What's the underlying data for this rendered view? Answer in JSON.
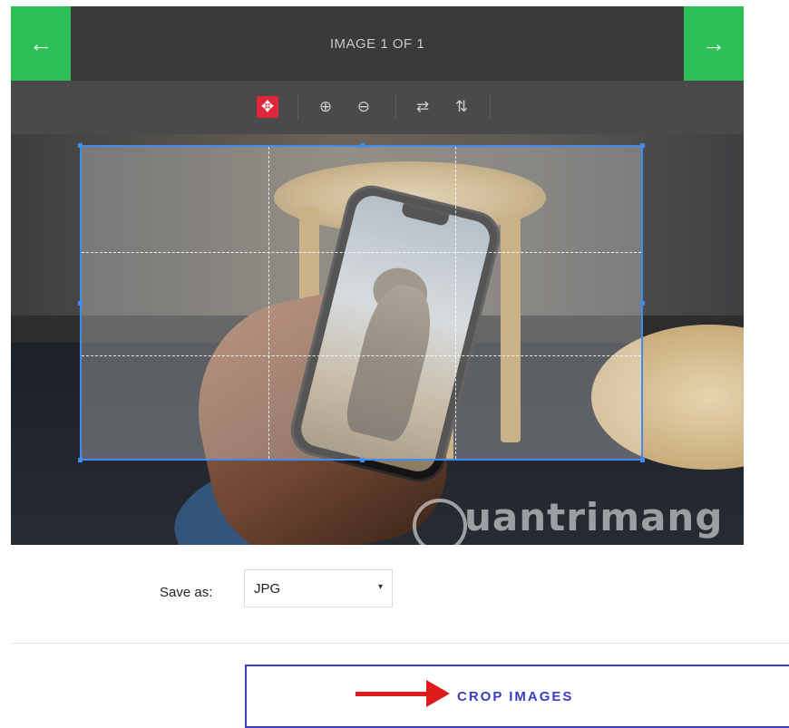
{
  "header": {
    "title": "IMAGE 1 OF 1",
    "prev_icon": "←",
    "next_icon": "→",
    "accent_color": "#2fbf57"
  },
  "toolbar": {
    "tools": [
      {
        "name": "move-icon",
        "glyph": "✥",
        "active": true
      },
      {
        "name": "zoom-in-icon",
        "glyph": "⊕"
      },
      {
        "name": "zoom-out-icon",
        "glyph": "⊖"
      },
      {
        "name": "flip-horizontal-icon",
        "glyph": "⇄"
      },
      {
        "name": "flip-vertical-icon",
        "glyph": "⇅"
      }
    ],
    "active_color": "#e0263a"
  },
  "watermark": {
    "text": "uantrimang"
  },
  "save": {
    "label": "Save as:",
    "selected": "JPG",
    "caret": "▾"
  },
  "crop_button": {
    "label": "CROP IMAGES",
    "color": "#3b3bc4"
  },
  "annotation": {
    "arrow_color": "#e01b1b"
  }
}
